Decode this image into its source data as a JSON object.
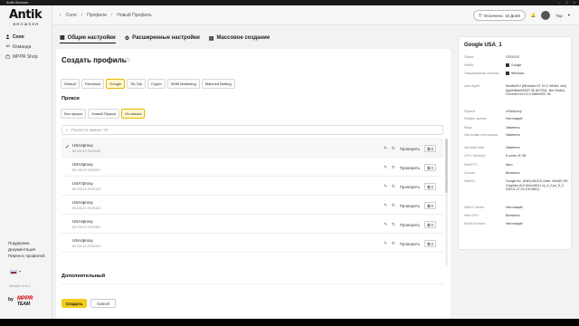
{
  "window": {
    "title": "Antik Browser"
  },
  "sidebar": {
    "logo_top": "Antik",
    "logo_bottom": "BROWSER",
    "items": [
      {
        "label": "Соло",
        "active": true
      },
      {
        "label": "Команда",
        "active": false
      },
      {
        "label": "MPPR Shop",
        "active": false
      }
    ],
    "links": [
      "Поддержка",
      "Документация",
      "Перенос профилей"
    ],
    "language_flag": "ru-flag",
    "version": "Version: v1.5.2",
    "by_label": "by",
    "partner_top": "MPPR",
    "partner_bottom": "TEAM"
  },
  "header": {
    "breadcrumb": [
      "Соло",
      "Профили",
      "Новый Профиль"
    ],
    "sep": "/",
    "plan": "Оплачено: 15 Дней",
    "user": "Top"
  },
  "tabs": [
    {
      "label": "Общие настройки",
      "active": true
    },
    {
      "label": "Расширенные настройки",
      "active": false
    },
    {
      "label": "Массовое создание",
      "active": false
    }
  ],
  "main": {
    "title": "Создать профиль",
    "platforms": [
      {
        "label": "Default",
        "active": false
      },
      {
        "label": "Facebook",
        "active": false
      },
      {
        "label": "Google",
        "active": true
      },
      {
        "label": "Tik-Tok",
        "active": false
      },
      {
        "label": "Crypto",
        "active": false
      },
      {
        "label": "SMM Marketing",
        "active": false
      },
      {
        "label": "Matched Betting",
        "active": false
      }
    ],
    "proxy_title": "Прокси",
    "proxy_modes": [
      {
        "label": "Без прокси",
        "active": false
      },
      {
        "label": "Новый Прокси",
        "active": false
      },
      {
        "label": "Из списка",
        "active": true
      }
    ],
    "search_placeholder": "Поиск по имени / IP",
    "check_label": "Проверить",
    "proxies": [
      {
        "name": "USA4proxy",
        "ip": "82.130.10.75:20000",
        "count": "0",
        "selected": true
      },
      {
        "name": "USA4proxy",
        "ip": "82.130.10.75:20407",
        "count": "0",
        "selected": false
      },
      {
        "name": "USA7proxy",
        "ip": "82.130.10.75:20123",
        "count": "0",
        "selected": false
      },
      {
        "name": "USA4proxy",
        "ip": "82.130.10.75:20132",
        "count": "0",
        "selected": false
      },
      {
        "name": "USA4proxy",
        "ip": "82.130.10.75:20351",
        "count": "0",
        "selected": false
      },
      {
        "name": "USA4proxy",
        "ip": "82.130.10.75:20119",
        "count": "0",
        "selected": false
      }
    ],
    "additional_title": "Дополнительный",
    "create_button": "Создать",
    "cancel_button": "Cancel"
  },
  "panel": {
    "title": "Google USA_1",
    "rows": [
      {
        "key": "Папка:",
        "value": "GOOGLE",
        "icon": false
      },
      {
        "key": "Лейбл:",
        "value": "Google",
        "icon": true
      },
      {
        "key": "Операционная система:",
        "value": "Windows",
        "icon": true
      },
      {
        "key": "User Agent:",
        "value": "Mozilla/5.0 (Windows NT 10.0; Win64; x64) AppleWebKit/537.36 (KHTML, like Gecko) Chrome/114.0.0.0 Safari/537.36",
        "icon": false
      },
      {
        "key": "Прокси:",
        "value": "USA4proxy",
        "icon": false
      },
      {
        "key": "Размер экрана:",
        "value": "Настоящий",
        "icon": false
      },
      {
        "key": "Язык:",
        "value": "Заменить",
        "icon": false
      },
      {
        "key": "Настройки геолокации:",
        "value": "Заменить",
        "icon": false
      },
      {
        "key": "Часовой пояс:",
        "value": "Заменить",
        "icon": false
      },
      {
        "key": "CPU / Memory:",
        "value": "8 cores / 8 GB",
        "icon": false
      },
      {
        "key": "WebRTC:",
        "value": "Авто",
        "icon": false
      },
      {
        "key": "Canvas:",
        "value": "Включить",
        "icon": false
      },
      {
        "key": "WebGL:",
        "value": "Google Inc. (Intel) ANGLE (Intel, Intel(R) HD Graphics 610 Direct3D11 vs_5_0 ps_5_0, D3D11-27.20.100.8681)",
        "icon": false
      },
      {
        "key": "WebGL Noise:",
        "value": "Настоящий",
        "icon": false
      },
      {
        "key": "Web GPU:",
        "value": "Включить",
        "icon": false
      },
      {
        "key": "Media Devices:",
        "value": "Настоящий",
        "icon": false
      }
    ]
  }
}
